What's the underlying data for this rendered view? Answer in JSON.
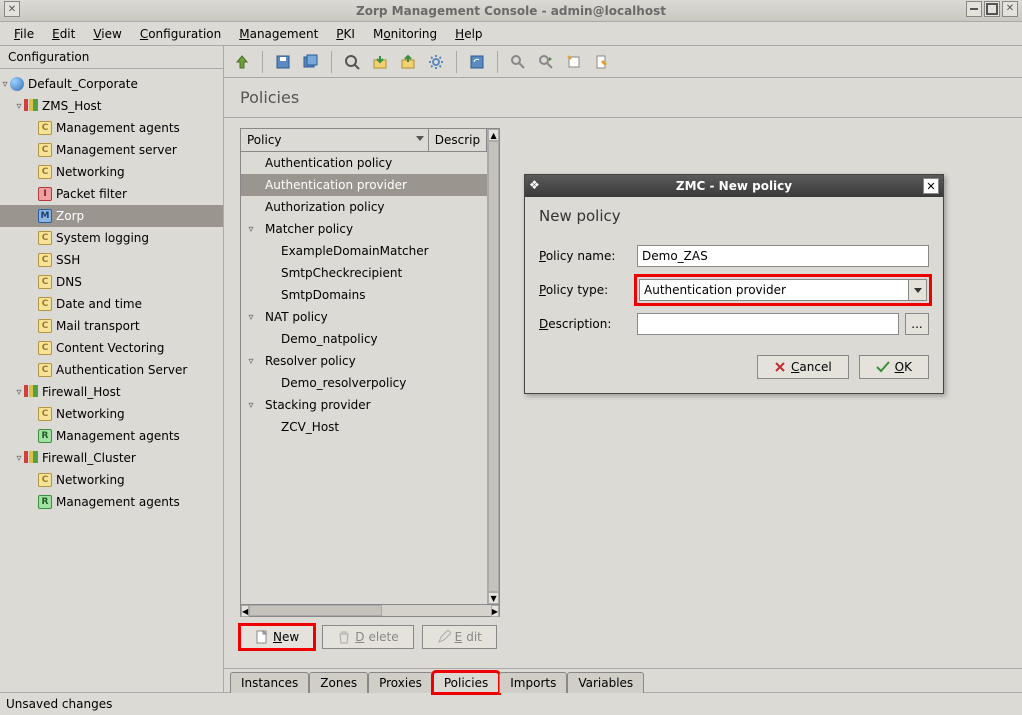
{
  "window": {
    "title": "Zorp Management Console - admin@localhost"
  },
  "menu": {
    "file": "File",
    "edit": "Edit",
    "view": "View",
    "configuration": "Configuration",
    "management": "Management",
    "pki": "PKI",
    "monitoring": "Monitoring",
    "help": "Help"
  },
  "sidebar": {
    "header": "Configuration",
    "tree": {
      "root": "Default_Corporate",
      "hosts": [
        {
          "name": "ZMS_Host",
          "items": [
            {
              "icon": "c",
              "label": "Management agents"
            },
            {
              "icon": "c",
              "label": "Management server"
            },
            {
              "icon": "c",
              "label": "Networking"
            },
            {
              "icon": "i",
              "label": "Packet filter"
            },
            {
              "icon": "m",
              "label": "Zorp",
              "selected": true
            },
            {
              "icon": "c",
              "label": "System logging"
            },
            {
              "icon": "c",
              "label": "SSH"
            },
            {
              "icon": "c",
              "label": "DNS"
            },
            {
              "icon": "c",
              "label": "Date and time"
            },
            {
              "icon": "c",
              "label": "Mail transport"
            },
            {
              "icon": "c",
              "label": "Content Vectoring"
            },
            {
              "icon": "c",
              "label": "Authentication Server"
            }
          ]
        },
        {
          "name": "Firewall_Host",
          "items": [
            {
              "icon": "c",
              "label": "Networking"
            },
            {
              "icon": "r",
              "label": "Management agents"
            }
          ]
        },
        {
          "name": "Firewall_Cluster",
          "items": [
            {
              "icon": "c",
              "label": "Networking"
            },
            {
              "icon": "r",
              "label": "Management agents"
            }
          ]
        }
      ]
    }
  },
  "page": {
    "title": "Policies"
  },
  "policyList": {
    "columns": {
      "policy": "Policy",
      "description": "Descrip"
    },
    "groups": [
      {
        "label": "Authentication policy",
        "expanded": false,
        "children": []
      },
      {
        "label": "Authentication provider",
        "expanded": false,
        "selected": true,
        "children": []
      },
      {
        "label": "Authorization policy",
        "expanded": false,
        "children": []
      },
      {
        "label": "Matcher policy",
        "expanded": true,
        "children": [
          "ExampleDomainMatcher",
          "SmtpCheckrecipient",
          "SmtpDomains"
        ]
      },
      {
        "label": "NAT policy",
        "expanded": true,
        "children": [
          "Demo_natpolicy"
        ]
      },
      {
        "label": "Resolver policy",
        "expanded": true,
        "children": [
          "Demo_resolverpolicy"
        ]
      },
      {
        "label": "Stacking provider",
        "expanded": true,
        "children": [
          "ZCV_Host"
        ]
      }
    ]
  },
  "buttons": {
    "new": "New",
    "delete": "Delete",
    "edit": "Edit"
  },
  "tabs": {
    "instances": "Instances",
    "zones": "Zones",
    "proxies": "Proxies",
    "policies": "Policies",
    "imports": "Imports",
    "variables": "Variables"
  },
  "dialog": {
    "title": "ZMC - New policy",
    "heading": "New policy",
    "labels": {
      "name": "Policy name:",
      "type": "Policy type:",
      "description": "Description:"
    },
    "values": {
      "name": "Demo_ZAS",
      "type": "Authentication provider",
      "description": ""
    },
    "dots": "...",
    "cancel": "Cancel",
    "ok": "OK"
  },
  "status": "Unsaved changes"
}
